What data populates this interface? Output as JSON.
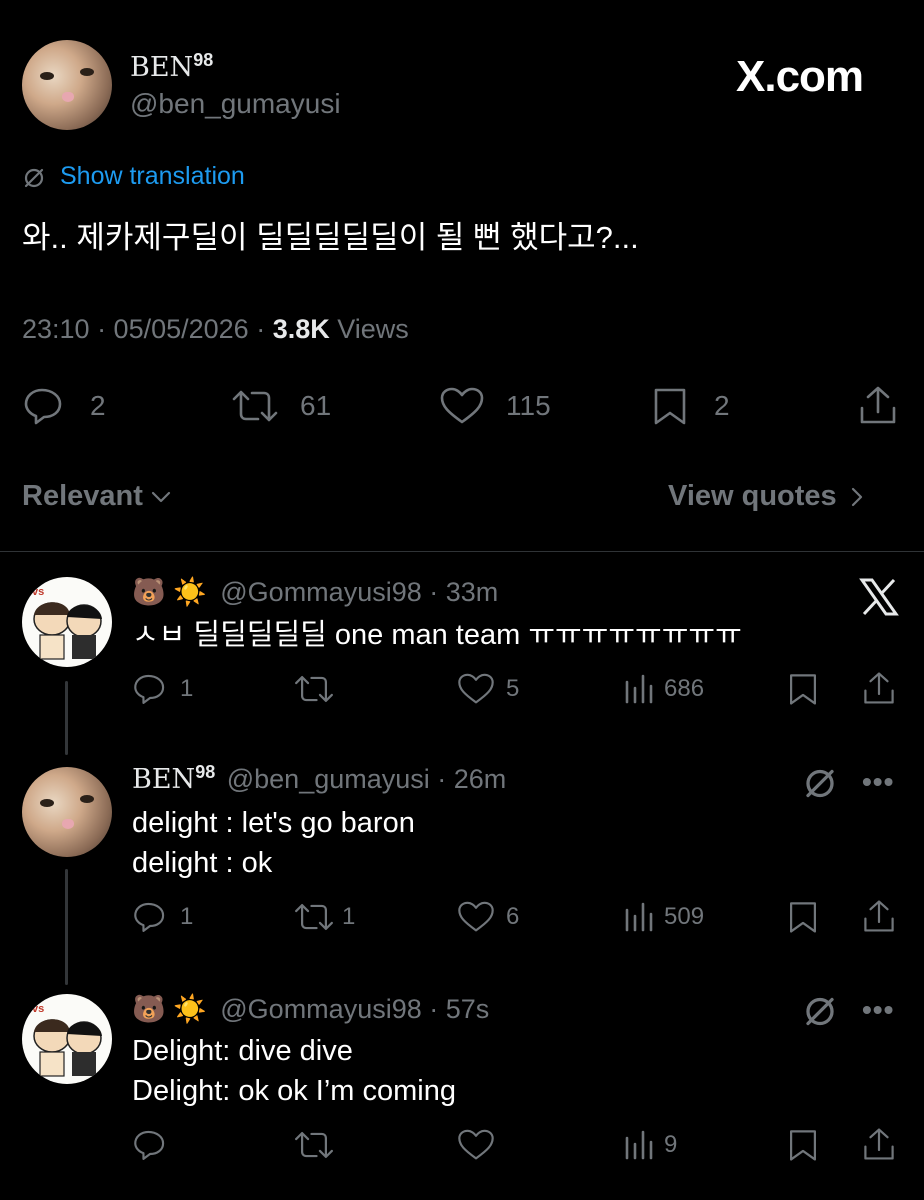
{
  "watermark": "X.com",
  "main_tweet": {
    "display_name": "BEN",
    "display_name_sup": "98",
    "handle": "@ben_gumayusi",
    "show_translation": "Show translation",
    "text": "와.. 제카제구딜이 딜딜딜딜딜이 될 뻔 했다고?...",
    "time": "23:10 · 05/05/2026 · ",
    "views_count": "3.8K",
    "views_label": " Views",
    "replies": "2",
    "reposts": "61",
    "likes": "115",
    "bookmarks": "2"
  },
  "sort": {
    "label": "Relevant",
    "view_quotes": "View quotes"
  },
  "replies": [
    {
      "emojis": "🐻 ☀️",
      "handle": "@Gommayusi98",
      "time": " · 33m",
      "lines": [
        "ㅅㅂ 딜딜딜딜딜 one man team ㅠㅠㅠㅠㅠㅠㅠㅠ"
      ],
      "replies": "1",
      "reposts": "",
      "likes": "5",
      "views": "686"
    },
    {
      "display_name": "BEN",
      "display_name_sup": "98",
      "handle": "@ben_gumayusi",
      "time": " · 26m",
      "lines": [
        "delight : let's go baron",
        "delight : ok"
      ],
      "replies": "1",
      "reposts": "1",
      "likes": "6",
      "views": "509"
    },
    {
      "emojis": "🐻 ☀️",
      "handle": "@Gommayusi98",
      "time": " · 57s",
      "lines": [
        "Delight: dive dive",
        "Delight: ok ok I’m coming"
      ],
      "replies": "",
      "reposts": "",
      "likes": "",
      "views": "9"
    }
  ],
  "colors": {
    "background": "#000000",
    "text": "#e7e9ea",
    "secondary": "#71767b",
    "link": "#1d9bf0",
    "divider": "#2f3336"
  }
}
